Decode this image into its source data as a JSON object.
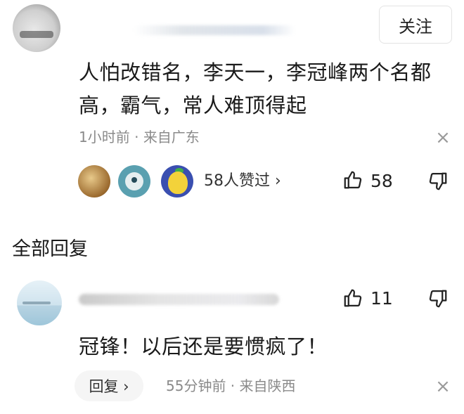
{
  "comment": {
    "follow_label": "关注",
    "text_line1": "人怕改错名，李天一，李冠峰两个名都",
    "text_line2": "高，霸气，常人难顶得起",
    "time": "1小时前",
    "meta_separator": " · ",
    "location": "来自广东",
    "likers_label": "58人赞过 ›",
    "like_count": "58",
    "close_glyph": "×"
  },
  "replies_section": {
    "title": "全部回复"
  },
  "reply": {
    "text": "冠锋！以后还是要惯疯了！",
    "like_count": "11",
    "reply_button_label": "回复 ›",
    "time": "55分钟前",
    "meta_separator": " · ",
    "location": "来自陕西",
    "close_glyph": "×"
  },
  "icons": {
    "like": "thumb-up-icon",
    "dislike": "thumb-down-icon",
    "close": "close-icon"
  }
}
